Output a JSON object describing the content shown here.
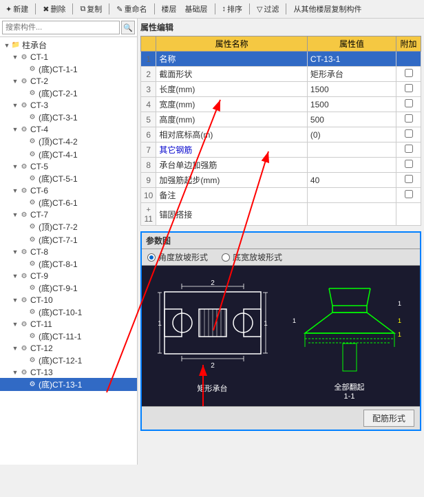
{
  "toolbar": {
    "row1_items": [
      "新建",
      "删除",
      "复制",
      "重命名",
      "楼层",
      "基础层",
      "排序",
      "过滤",
      "从其他楼层复制构件"
    ],
    "new_label": "新建",
    "delete_label": "删除",
    "copy_label": "复制",
    "rename_label": "重命名",
    "layer_label": "楼层",
    "base_layer_label": "基础层",
    "sort_label": "排序",
    "filter_label": "过滤",
    "import_label": "从其他楼层复制构件"
  },
  "search": {
    "placeholder": "搜索构件..."
  },
  "tree": {
    "root_label": "柱承台",
    "nodes": [
      {
        "id": "ct1",
        "label": "CT-1",
        "level": 1,
        "type": "folder",
        "expanded": true
      },
      {
        "id": "ct1-1",
        "label": "(底)CT-1-1",
        "level": 2,
        "type": "item"
      },
      {
        "id": "ct2",
        "label": "CT-2",
        "level": 1,
        "type": "folder",
        "expanded": true
      },
      {
        "id": "ct2-1",
        "label": "(底)CT-2-1",
        "level": 2,
        "type": "item"
      },
      {
        "id": "ct3",
        "label": "CT-3",
        "level": 1,
        "type": "folder",
        "expanded": true
      },
      {
        "id": "ct3-1",
        "label": "(底)CT-3-1",
        "level": 2,
        "type": "item"
      },
      {
        "id": "ct4",
        "label": "CT-4",
        "level": 1,
        "type": "folder",
        "expanded": true
      },
      {
        "id": "ct4-2",
        "label": "(顶)CT-4-2",
        "level": 2,
        "type": "item"
      },
      {
        "id": "ct4-1",
        "label": "(底)CT-4-1",
        "level": 2,
        "type": "item"
      },
      {
        "id": "ct5",
        "label": "CT-5",
        "level": 1,
        "type": "folder",
        "expanded": true
      },
      {
        "id": "ct5-1",
        "label": "(底)CT-5-1",
        "level": 2,
        "type": "item"
      },
      {
        "id": "ct6",
        "label": "CT-6",
        "level": 1,
        "type": "folder",
        "expanded": true
      },
      {
        "id": "ct6-1",
        "label": "(底)CT-6-1",
        "level": 2,
        "type": "item"
      },
      {
        "id": "ct7",
        "label": "CT-7",
        "level": 1,
        "type": "folder",
        "expanded": true
      },
      {
        "id": "ct7-2",
        "label": "(顶)CT-7-2",
        "level": 2,
        "type": "item"
      },
      {
        "id": "ct7-1",
        "label": "(底)CT-7-1",
        "level": 2,
        "type": "item"
      },
      {
        "id": "ct8",
        "label": "CT-8",
        "level": 1,
        "type": "folder",
        "expanded": true
      },
      {
        "id": "ct8-1",
        "label": "(底)CT-8-1",
        "level": 2,
        "type": "item"
      },
      {
        "id": "ct9",
        "label": "CT-9",
        "level": 1,
        "type": "folder",
        "expanded": true
      },
      {
        "id": "ct9-1",
        "label": "(底)CT-9-1",
        "level": 2,
        "type": "item"
      },
      {
        "id": "ct10",
        "label": "CT-10",
        "level": 1,
        "type": "folder",
        "expanded": true
      },
      {
        "id": "ct10-1",
        "label": "(底)CT-10-1",
        "level": 2,
        "type": "item"
      },
      {
        "id": "ct11",
        "label": "CT-11",
        "level": 1,
        "type": "folder",
        "expanded": true
      },
      {
        "id": "ct11-1",
        "label": "(底)CT-11-1",
        "level": 2,
        "type": "item"
      },
      {
        "id": "ct12",
        "label": "CT-12",
        "level": 1,
        "type": "folder",
        "expanded": true
      },
      {
        "id": "ct12-1",
        "label": "(底)CT-12-1",
        "level": 2,
        "type": "item"
      },
      {
        "id": "ct13",
        "label": "CT-13",
        "level": 1,
        "type": "folder",
        "expanded": true
      },
      {
        "id": "ct13-1",
        "label": "(底)CT-13-1",
        "level": 2,
        "type": "item",
        "selected": true
      }
    ]
  },
  "properties": {
    "title": "属性编辑",
    "headers": [
      "属性名称",
      "属性值",
      "附加"
    ],
    "rows": [
      {
        "num": 1,
        "name": "名称",
        "value": "CT-13-1",
        "addable": false,
        "blue": true,
        "selected": true
      },
      {
        "num": 2,
        "name": "截面形状",
        "value": "矩形承台",
        "addable": false,
        "blue": false
      },
      {
        "num": 3,
        "name": "长度(mm)",
        "value": "1500",
        "addable": false,
        "blue": false
      },
      {
        "num": 4,
        "name": "宽度(mm)",
        "value": "1500",
        "addable": false,
        "blue": false
      },
      {
        "num": 5,
        "name": "高度(mm)",
        "value": "500",
        "addable": false,
        "blue": false
      },
      {
        "num": 6,
        "name": "相对底标高(m)",
        "value": "(0)",
        "addable": false,
        "blue": false
      },
      {
        "num": 7,
        "name": "其它钢筋",
        "value": "",
        "addable": false,
        "blue": true
      },
      {
        "num": 8,
        "name": "承台单边加强筋",
        "value": "",
        "addable": false,
        "blue": false
      },
      {
        "num": 9,
        "name": "加强筋起步(mm)",
        "value": "40",
        "addable": false,
        "blue": false
      },
      {
        "num": 10,
        "name": "备注",
        "value": "",
        "addable": false,
        "blue": false
      },
      {
        "num": 11,
        "name": "锚固搭接",
        "value": "",
        "addable": true,
        "blue": false
      }
    ]
  },
  "reference_diagram": {
    "title": "参数图",
    "radio_options": [
      "角度放坡形式",
      "底宽放坡形式"
    ],
    "selected_radio": 0,
    "left_diagram_label": "矩形承台",
    "right_diagram_label": "全部翻起",
    "right_label2": "1-1",
    "config_btn_label": "配筋形式"
  }
}
